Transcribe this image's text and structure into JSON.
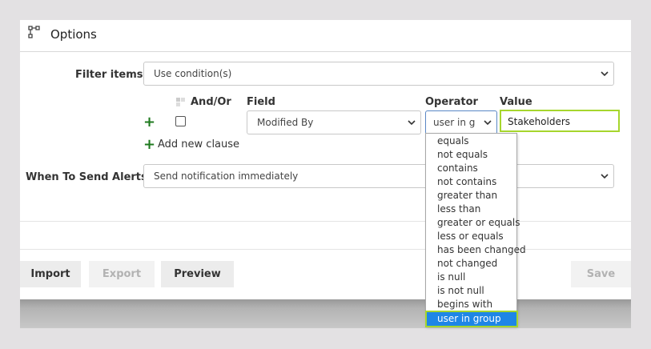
{
  "header": {
    "title": "Options",
    "icon": "flow-diagram-icon"
  },
  "filter": {
    "label": "Filter items",
    "select_value": "Use condition(s)",
    "and_or_label": "And/Or",
    "field_label": "Field",
    "operator_label": "Operator",
    "value_label": "Value",
    "field_value": "Modified By",
    "operator_value": "user in g",
    "value_input": "Stakeholders",
    "add_clause": "Add new clause"
  },
  "alerts": {
    "label": "When To Send Alerts",
    "select_value": "Send notification immediately"
  },
  "buttons": {
    "import": "Import",
    "export": "Export",
    "preview": "Preview",
    "save": "Save"
  },
  "operator_options": [
    "equals",
    "not equals",
    "contains",
    "not contains",
    "greater than",
    "less than",
    "greater or equals",
    "less or equals",
    "has been changed",
    "not changed",
    "is null",
    "is not null",
    "begins with",
    "user in group"
  ],
  "colors": {
    "accent_green": "#a6d62d",
    "selected_blue": "#1e86e6",
    "plus_green": "#1f7a1f"
  }
}
